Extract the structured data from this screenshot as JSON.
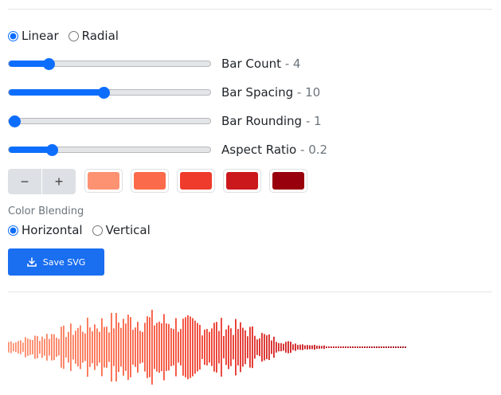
{
  "layout_mode": {
    "options": [
      {
        "label": "Linear",
        "checked": true
      },
      {
        "label": "Radial",
        "checked": false
      }
    ]
  },
  "sliders": [
    {
      "label": "Bar Count",
      "sep": " - ",
      "value": "4",
      "fraction": 0.18
    },
    {
      "label": "Bar Spacing",
      "sep": " - ",
      "value": "10",
      "fraction": 0.47
    },
    {
      "label": "Bar Rounding",
      "sep": " - ",
      "value": "1",
      "fraction": 0.0
    },
    {
      "label": "Aspect Ratio",
      "sep": " - ",
      "value": "0.2",
      "fraction": 0.2
    }
  ],
  "color_buttons": {
    "minus": "−",
    "plus": "+"
  },
  "palette": [
    "#fc9272",
    "#fb6a4a",
    "#ef3b2c",
    "#cb181d",
    "#99000d"
  ],
  "color_blending": {
    "label": "Color Blending",
    "options": [
      {
        "label": "Horizontal",
        "checked": true
      },
      {
        "label": "Vertical",
        "checked": false
      }
    ]
  },
  "save_button": {
    "label": "Save SVG",
    "icon": "download-icon"
  },
  "accent": "#0d6efd"
}
